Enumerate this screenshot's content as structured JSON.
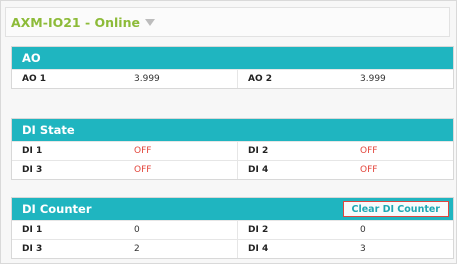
{
  "header": {
    "title": "AXM-IO21 - Online"
  },
  "ao": {
    "title": "AO",
    "rows": [
      {
        "l1": "AO 1",
        "v1": "3.999",
        "l2": "AO 2",
        "v2": "3.999"
      }
    ]
  },
  "di_state": {
    "title": "DI State",
    "rows": [
      {
        "l1": "DI 1",
        "v1": "OFF",
        "l2": "DI 2",
        "v2": "OFF"
      },
      {
        "l1": "DI 3",
        "v1": "OFF",
        "l2": "DI 4",
        "v2": "OFF"
      }
    ]
  },
  "di_counter": {
    "title": "DI Counter",
    "button": "Clear DI Counter",
    "rows": [
      {
        "l1": "DI 1",
        "v1": "0",
        "l2": "DI 2",
        "v2": "0"
      },
      {
        "l1": "DI 3",
        "v1": "2",
        "l2": "DI 4",
        "v2": "3"
      }
    ]
  },
  "colors": {
    "accent": "#1fb5c0",
    "title_green": "#8dbb39",
    "off_red": "#e3463c",
    "button_border": "#e0463f"
  }
}
